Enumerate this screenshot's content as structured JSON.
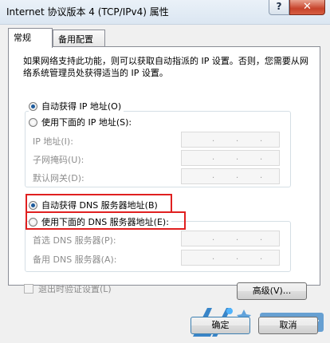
{
  "window": {
    "title": "Internet 协议版本 4 (TCP/IPv4) 属性",
    "help_label": "?",
    "close_label": "✕"
  },
  "tabs": [
    {
      "label": "常规",
      "active": true
    },
    {
      "label": "备用配置",
      "active": false
    }
  ],
  "description": "如果网络支持此功能，则可以获取自动指派的 IP 设置。否则，您需要从网络系统管理员处获得适当的 IP 设置。",
  "ip_section": {
    "auto_label": "自动获得 IP 地址(O)",
    "manual_label": "使用下面的 IP 地址(S):",
    "fields": [
      {
        "label": "IP 地址(I):"
      },
      {
        "label": "子网掩码(U):"
      },
      {
        "label": "默认网关(D):"
      }
    ]
  },
  "dns_section": {
    "auto_label": "自动获得 DNS 服务器地址(B)",
    "manual_label": "使用下面的 DNS 服务器地址(E):",
    "fields": [
      {
        "label": "首选 DNS 服务器(P):"
      },
      {
        "label": "备用 DNS 服务器(A):"
      }
    ]
  },
  "ip_separator": ".",
  "validate_label": "退出时验证设置(L)",
  "advanced_label": "高级(V)...",
  "ok_label": "确定",
  "cancel_label": "取消",
  "colors": {
    "highlight": "#e02020",
    "accent": "#1c5a9c"
  }
}
